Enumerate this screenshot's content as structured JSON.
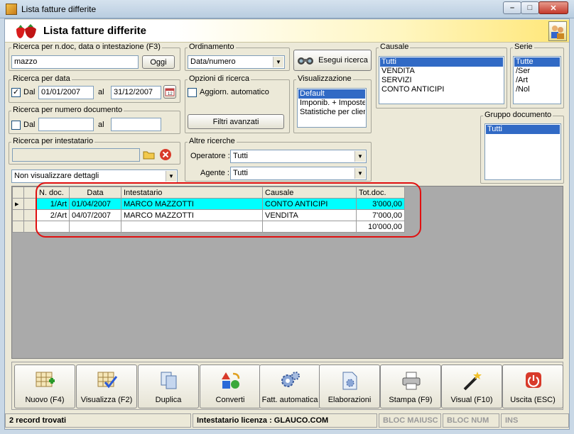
{
  "window": {
    "title": "Lista fatture differite",
    "min_label": "–",
    "max_label": "□",
    "close_label": "✕"
  },
  "header": {
    "title": "Lista fatture differite"
  },
  "search_text": {
    "label": "Ricerca per n.doc, data o intestazione (F3)",
    "value": "mazzo",
    "button": "Oggi"
  },
  "search_date": {
    "label": "Ricerca per data",
    "checked": "✓",
    "from_label": "Dal",
    "from_value": "01/01/2007",
    "to_label": "al",
    "to_value": "31/12/2007"
  },
  "search_number": {
    "label": "Ricerca per numero documento",
    "from_label": "Dal",
    "from_value": "",
    "to_label": "al",
    "to_value": ""
  },
  "search_holder": {
    "label": "Ricerca per intestatario",
    "value": ""
  },
  "details_combo": {
    "value": "Non visualizzare dettagli"
  },
  "ordering": {
    "label": "Ordinamento",
    "value": "Data/numero"
  },
  "execute_button": "Esegui ricerca",
  "search_options": {
    "label": "Opzioni di ricerca",
    "auto_update": "Aggiorn. automatico",
    "advanced_filters": "Filtri avanzati"
  },
  "view": {
    "label": "Visualizzazione",
    "items": [
      "Default",
      "Imponib. + Imposte",
      "Statistiche per clien"
    ],
    "selected": 0
  },
  "other_searches": {
    "label": "Altre ricerche",
    "operator_label": "Operatore :",
    "operator_value": "Tutti",
    "agent_label": "Agente :",
    "agent_value": "Tutti"
  },
  "causale": {
    "label": "Causale",
    "items": [
      "Tutti",
      "VENDITA",
      "SERVIZI",
      "CONTO ANTICIPI"
    ],
    "selected": 0
  },
  "serie": {
    "label": "Serie",
    "items": [
      "Tutte",
      "/Ser",
      "/Art",
      "/Nol"
    ],
    "selected": 0
  },
  "doc_group": {
    "label": "Gruppo documento",
    "items": [
      "Tutti"
    ],
    "selected": 0
  },
  "grid": {
    "columns": [
      "N. doc.",
      "Data",
      "Intestatario",
      "Causale",
      "Tot.doc."
    ],
    "rows": [
      {
        "ndoc": "1/Art",
        "data": "01/04/2007",
        "intestatario": "MARCO MAZZOTTI",
        "causale": "CONTO ANTICIPI",
        "tot": "3'000,00"
      },
      {
        "ndoc": "2/Art",
        "data": "04/07/2007",
        "intestatario": "MARCO MAZZOTTI",
        "causale": "VENDITA",
        "tot": "7'000,00"
      }
    ],
    "total": "10'000,00"
  },
  "toolbar": {
    "new": "Nuovo (F4)",
    "view": "Visualizza (F2)",
    "duplicate": "Duplica",
    "convert": "Converti",
    "auto_invoice": "Fatt. automatica",
    "processing": "Elaborazioni",
    "print": "Stampa (F9)",
    "visual": "Visual (F10)",
    "exit": "Uscita (ESC)"
  },
  "status": {
    "records": "2 record trovati",
    "license": "Intestatario licenza : GLAUCO.COM",
    "caps": "BLOC MAIUSC",
    "num": "BLOC NUM",
    "ins": "INS"
  }
}
